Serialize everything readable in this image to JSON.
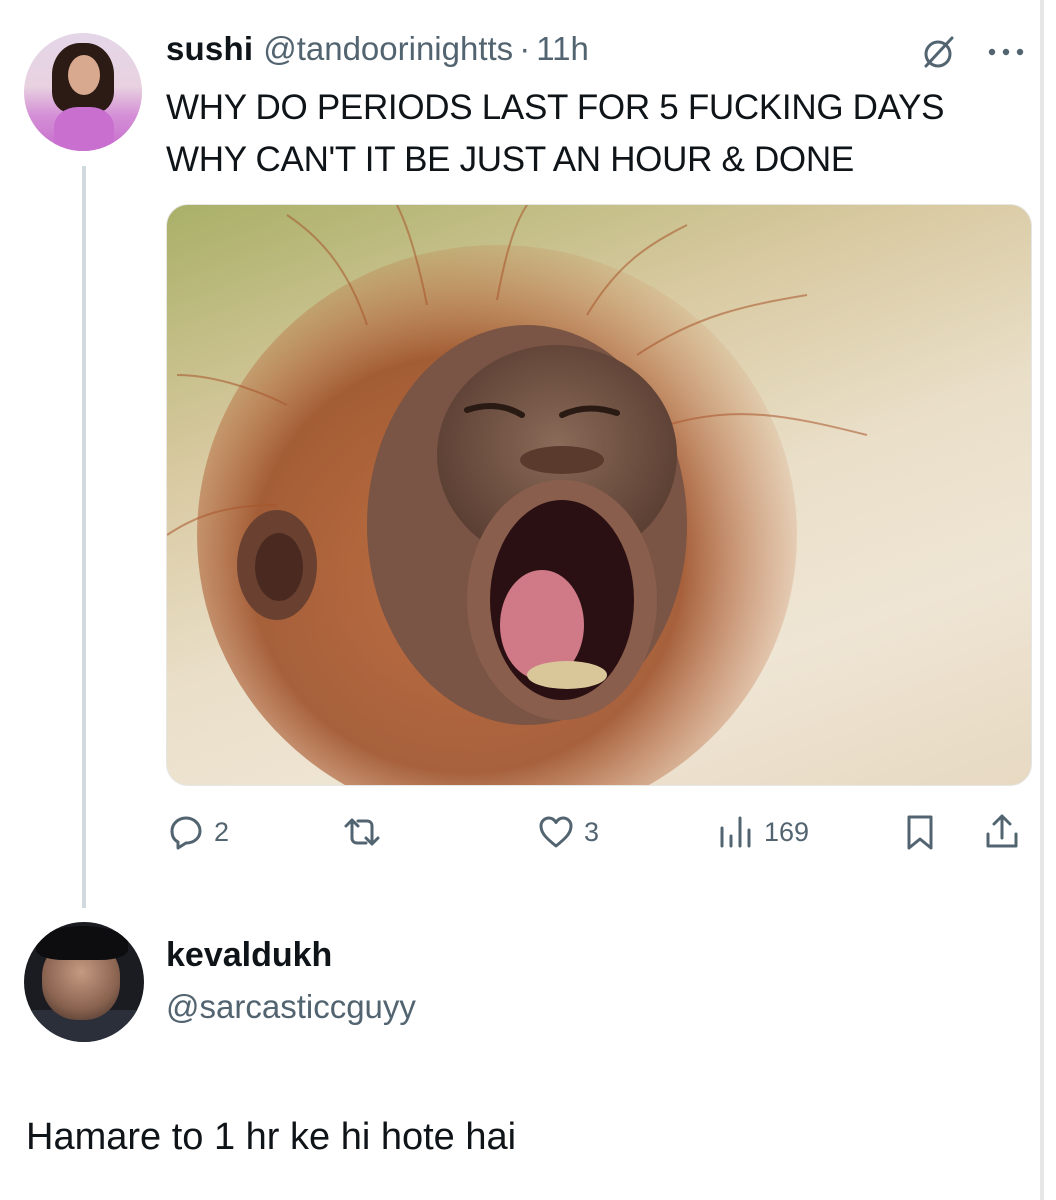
{
  "tweet": {
    "author_name": "sushi",
    "author_handle": "@tandoorinightts",
    "separator": "·",
    "time": "11h",
    "text_lines": [
      "WHY DO PERIODS LAST FOR 5 FUCKING DAYS",
      "WHY CAN'T IT BE JUST AN HOUR & DONE"
    ],
    "stats": {
      "replies": "2",
      "retweets": "",
      "likes": "3",
      "views": "169"
    },
    "icons": {
      "grok": "grok-slash-icon",
      "more": "more-dots-icon",
      "reply": "reply-bubble-icon",
      "retweet": "retweet-icon",
      "like": "heart-icon",
      "views": "views-bar-icon",
      "bookmark": "bookmark-icon",
      "share": "share-icon"
    },
    "media_subject": "orangutan-yawning-photo"
  },
  "reply": {
    "author_name": "kevaldukh",
    "author_handle": "@sarcasticcguyy",
    "text": "Hamare to 1 hr ke hi hote hai"
  },
  "colors": {
    "text": "#0f1419",
    "secondary": "#536471",
    "thread_line": "#cfd9de"
  }
}
